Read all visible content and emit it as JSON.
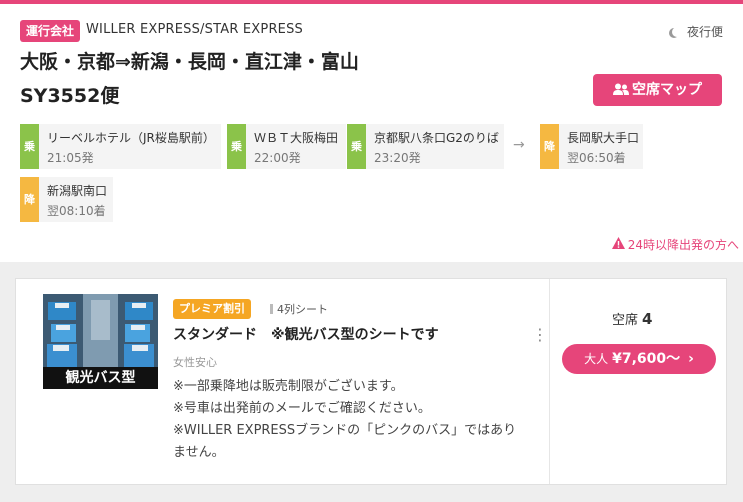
{
  "header": {
    "operator_badge": "運行会社",
    "operator_name": "WILLER EXPRESS/STAR EXPRESS",
    "night_label": "夜行便",
    "route_title": "大阪・京都⇒新潟・長岡・直江津・富山",
    "flight_no": "SY3552便",
    "seatmap_button": "空席マップ"
  },
  "stops": [
    {
      "type": "乗",
      "name": "リーベルホテル（JR桜島駅前）",
      "time": "21:05発"
    },
    {
      "type": "乗",
      "name": "ＷＢＴ大阪梅田",
      "time": "22:00発"
    },
    {
      "type": "乗",
      "name": "京都駅八条口G2のりば",
      "time": "23:20発"
    },
    {
      "type": "降",
      "name": "長岡駅大手口",
      "time": "翌06:50着"
    },
    {
      "type": "降",
      "name": "新潟駅南口",
      "time": "翌08:10着"
    }
  ],
  "arrow": "→",
  "notice": "24時以降出発の方へ",
  "plan": {
    "image_caption": "観光バス型",
    "premium_badge": "プレミア割引",
    "seat_rows": "4列シート",
    "title": "スタンダード　※観光バス型のシートです",
    "female_safe": "女性安心",
    "notes": [
      "※一部乗降地は販売制限がございます。",
      "※号車は出発前のメールでご確認ください。",
      "※WILLER EXPRESSブランドの「ピンクのバス」ではあり",
      "ません。"
    ],
    "vacancy_label": "空席",
    "vacancy_count": "4",
    "adult_label": "大人",
    "price": "¥7,600〜",
    "chevron": "›",
    "more": "⋮"
  },
  "colors": {
    "accent": "#e6457a",
    "board": "#8bc34a",
    "alight": "#f5b841",
    "premium": "#f5a623"
  }
}
